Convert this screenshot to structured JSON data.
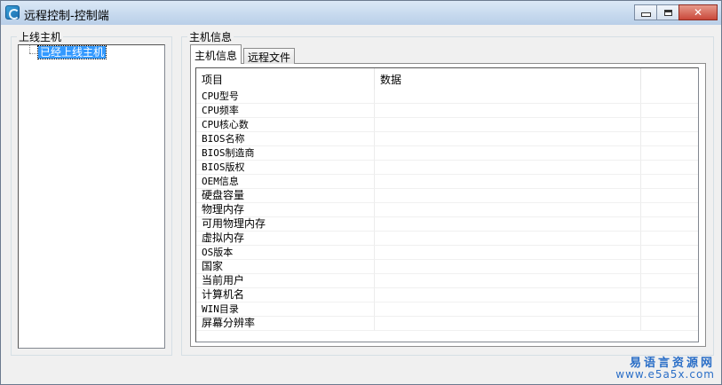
{
  "window": {
    "title": "远程控制-控制端",
    "app_icon": "app-logo-icon",
    "controls": [
      "minimize-icon",
      "maximize-icon",
      "close-icon"
    ],
    "close_glyph": "✕"
  },
  "left_group": {
    "legend": "上线主机",
    "tree": {
      "items": [
        {
          "label": "已经上线主机",
          "selected": true
        }
      ]
    }
  },
  "right_group": {
    "legend": "主机信息",
    "tabs": [
      {
        "label": "主机信息",
        "active": true
      },
      {
        "label": "远程文件",
        "active": false
      }
    ],
    "table": {
      "columns": [
        "项目",
        "数据",
        ""
      ],
      "rows": [
        {
          "item": "CPU型号",
          "value": ""
        },
        {
          "item": "CPU频率",
          "value": ""
        },
        {
          "item": "CPU核心数",
          "value": ""
        },
        {
          "item": "BIOS名称",
          "value": ""
        },
        {
          "item": "BIOS制造商",
          "value": ""
        },
        {
          "item": "BIOS版权",
          "value": ""
        },
        {
          "item": "OEM信息",
          "value": ""
        },
        {
          "item": "硬盘容量",
          "value": ""
        },
        {
          "item": "物理内存",
          "value": ""
        },
        {
          "item": "可用物理内存",
          "value": ""
        },
        {
          "item": "虚拟内存",
          "value": ""
        },
        {
          "item": "OS版本",
          "value": ""
        },
        {
          "item": "国家",
          "value": ""
        },
        {
          "item": "当前用户",
          "value": ""
        },
        {
          "item": "计算机名",
          "value": ""
        },
        {
          "item": "WIN目录",
          "value": ""
        },
        {
          "item": "屏幕分辨率",
          "value": ""
        }
      ]
    }
  },
  "watermark": {
    "line1": "易语言资源网",
    "line2": "www.e5a5x.com"
  },
  "colors": {
    "selection": "#3399ff",
    "watermark": "#2a6ec7",
    "close_button": "#c9483a"
  }
}
